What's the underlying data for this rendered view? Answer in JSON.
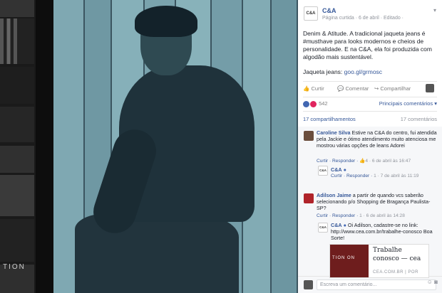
{
  "brand": {
    "logo_text": "C&A",
    "name": "C&A"
  },
  "post": {
    "meta": "Página curtida · 6 de abril · Editado ·",
    "text": "Denim & Atitude. A tradicional jaqueta jeans é #musthave para looks modernos e cheios de personalidade. E na C&A, ela foi produzida com algodão mais sustentável.",
    "link_prefix": "Jaqueta jeans:",
    "link": "goo.gl/grmosc"
  },
  "actions": {
    "like": "Curtir",
    "comment": "Comentar",
    "share": "Compartilhar"
  },
  "stats": {
    "reactions": "542",
    "top_comments": "Principais comentários ▾",
    "shares": "17 compartilhamentos",
    "comments_count": "17 comentários"
  },
  "comments": [
    {
      "name": "Caroline Silva",
      "text": "Estive na C&A do centro, fui atendida pela Jackie e ótimo atendimento muito atenciosa me mostrou várias opções de leans Adorei",
      "foot_links": "Curtir · Responder ·",
      "foot_count": "4",
      "foot_date": "· 6 de abril às 16:47"
    },
    {
      "name": "C&A",
      "text": "",
      "foot_links": "Curtir · Responder ·",
      "foot_count": "",
      "foot_date": "1 · 7 de abril às 11:19"
    },
    {
      "name": "Adilson Jaime",
      "text": "a partir de quando vcs saberão selecionando p/o Shopping de Bragança Paulista-SP?",
      "foot_links": "Curtir · Responder ·",
      "foot_count": "",
      "foot_date": "1 · 6 de abril às 14:28"
    },
    {
      "name": "C&A",
      "text": "Oi Adilson, cadastre-se no link: http://www.cea.com.br/trabalhe-conosco Boa Sorte!",
      "foot_links": "",
      "foot_count": "",
      "foot_date": ""
    }
  ],
  "job_card": {
    "image_text": "TION ON",
    "title": "Trabalhe",
    "subtitle": "conosco — cea",
    "domain": "CEA.COM.BR | POR"
  },
  "composer": {
    "placeholder": "Escreva um comentário..."
  },
  "left_label": "TION"
}
